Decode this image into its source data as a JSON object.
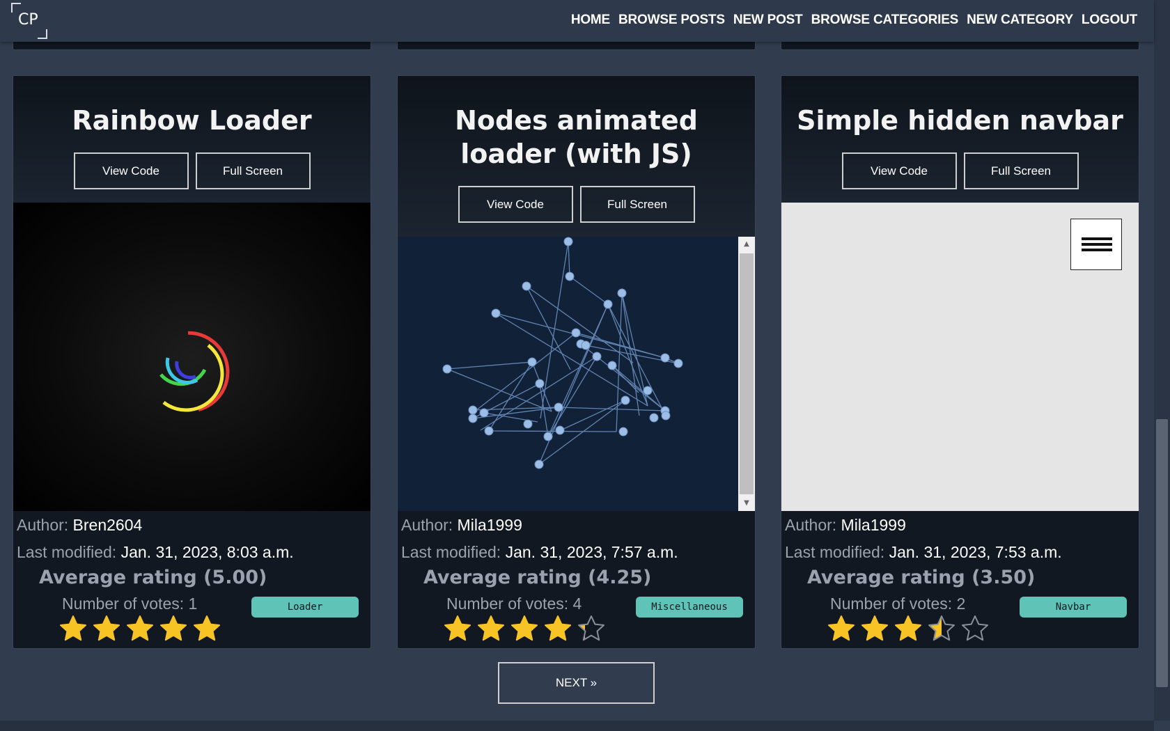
{
  "navbar": {
    "logo_text": "CP",
    "links": [
      "HOME",
      "BROWSE POSTS",
      "NEW POST",
      "BROWSE CATEGORIES",
      "NEW CATEGORY",
      "LOGOUT"
    ]
  },
  "cards": [
    {
      "title": "Rainbow Loader",
      "view_code": "View Code",
      "full_screen": "Full Screen",
      "author_label": "Author:",
      "author": "Bren2604",
      "modified_label": "Last modified:",
      "modified": "Jan. 31, 2023, 8:03 a.m.",
      "avg_rating": "Average rating (5.00)",
      "votes": "Number of votes: 1",
      "category": "Loader",
      "rating": 5.0
    },
    {
      "title": "Nodes animated loader (with JS)",
      "view_code": "View Code",
      "full_screen": "Full Screen",
      "author_label": "Author:",
      "author": "Mila1999",
      "modified_label": "Last modified:",
      "modified": "Jan. 31, 2023, 7:57 a.m.",
      "avg_rating": "Average rating (4.25)",
      "votes": "Number of votes: 4",
      "category": "Miscellaneous",
      "rating": 4.25
    },
    {
      "title": "Simple hidden navbar",
      "view_code": "View Code",
      "full_screen": "Full Screen",
      "author_label": "Author:",
      "author": "Mila1999",
      "modified_label": "Last modified:",
      "modified": "Jan. 31, 2023, 7:53 a.m.",
      "avg_rating": "Average rating (3.50)",
      "votes": "Number of votes: 2",
      "category": "Navbar",
      "rating": 3.5
    }
  ],
  "pagination": {
    "next_label": "NEXT »"
  },
  "colors": {
    "background": "#313d4f",
    "card": "#111821",
    "badge": "#5fc3b8",
    "star": "#f7c325"
  }
}
